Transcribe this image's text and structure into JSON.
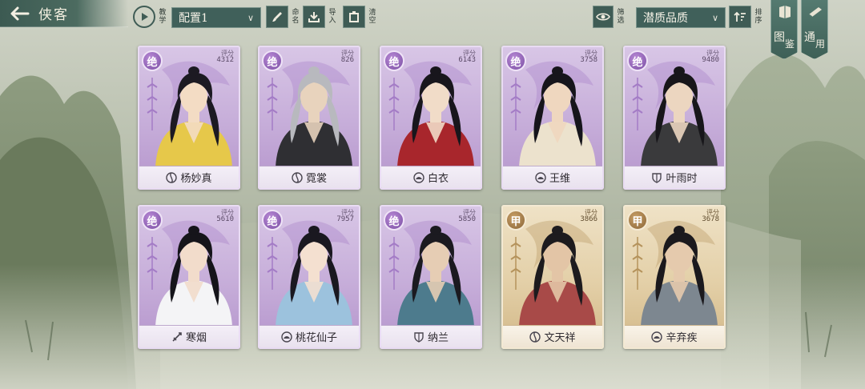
{
  "header": {
    "title": "侠客"
  },
  "toolbar": {
    "tutorial_label": "教学",
    "config_value": "配置1",
    "rename_label": "命名",
    "import_label": "导入",
    "clear_label": "清空",
    "filter_label": "筛选",
    "sort_select_value": "潜质品质",
    "sort_label": "排序"
  },
  "side_tabs": [
    {
      "label_a": "图",
      "label_b": "鉴"
    },
    {
      "label_a": "通",
      "label_b": "用"
    }
  ],
  "score_label": "评分",
  "cards": [
    {
      "rank": "绝",
      "tier": "jue",
      "score": "4312",
      "name": "杨妙真",
      "sect_icon": "sect-circle-icon",
      "hair": "#1c1a22",
      "robe": "#e6c84a",
      "skin": "#f3dcc4"
    },
    {
      "rank": "绝",
      "tier": "jue",
      "score": "826",
      "name": "霓裳",
      "sect_icon": "sect-circle-icon",
      "hair": "#b8b9be",
      "robe": "#2f2f33",
      "skin": "#e8d3bd"
    },
    {
      "rank": "绝",
      "tier": "jue",
      "score": "6143",
      "name": "白衣",
      "sect_icon": "sect-lotus-icon",
      "hair": "#18161c",
      "robe": "#a8262c",
      "skin": "#f1dcc8"
    },
    {
      "rank": "绝",
      "tier": "jue",
      "score": "3758",
      "name": "王维",
      "sect_icon": "sect-lotus-icon",
      "hair": "#16151b",
      "robe": "#ece2cd",
      "skin": "#efd7bf"
    },
    {
      "rank": "绝",
      "tier": "jue",
      "score": "9480",
      "name": "叶雨时",
      "sect_icon": "sect-shield-icon",
      "hair": "#17161a",
      "robe": "#3a3a3c",
      "skin": "#ecd6c0"
    },
    {
      "rank": "绝",
      "tier": "jue",
      "score": "5610",
      "name": "寒烟",
      "sect_icon": "sect-sword-icon",
      "hair": "#15141a",
      "robe": "#f4f4f6",
      "skin": "#f2dccb"
    },
    {
      "rank": "绝",
      "tier": "jue",
      "score": "7957",
      "name": "桃花仙子",
      "sect_icon": "sect-lotus-icon",
      "hair": "#1a1820",
      "robe": "#9cc2dd",
      "skin": "#f4e0d0"
    },
    {
      "rank": "绝",
      "tier": "jue",
      "score": "5850",
      "name": "纳兰",
      "sect_icon": "sect-shield-icon",
      "hair": "#1b1a20",
      "robe": "#4d7b8d",
      "skin": "#e6cdb4"
    },
    {
      "rank": "甲",
      "tier": "jia",
      "score": "3866",
      "name": "文天祥",
      "sect_icon": "sect-circle-icon",
      "hair": "#1d1b1e",
      "robe": "#a84a48",
      "skin": "#e3c5a6"
    },
    {
      "rank": "甲",
      "tier": "jia",
      "score": "3678",
      "name": "辛弃疾",
      "sect_icon": "sect-lotus-icon",
      "hair": "#1b191d",
      "robe": "#7d8790",
      "skin": "#e5caad"
    }
  ]
}
